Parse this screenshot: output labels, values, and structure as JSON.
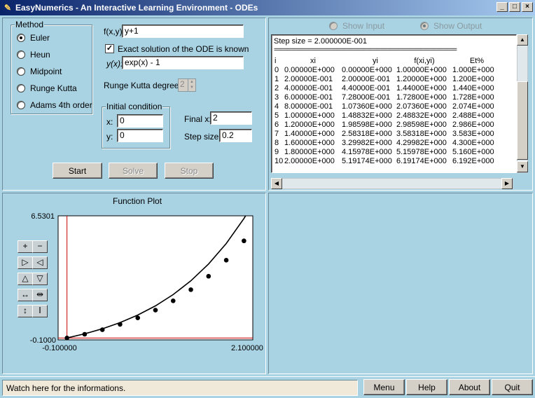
{
  "window": {
    "title": "EasyNumerics - An Interactive Learning Environment - ODEs",
    "buttons": [
      "_",
      "□",
      "×"
    ]
  },
  "method": {
    "legend": "Method",
    "options": [
      "Euler",
      "Heun",
      "Midpoint",
      "Runge Kutta",
      "Adams 4th order"
    ],
    "selected": "Euler"
  },
  "ode": {
    "fxy_label": "f(x,y):",
    "fxy_value": "y+1",
    "exact_checkbox_label": "Exact solution of the ODE is known",
    "exact_checked": true,
    "yx_label": "y(x):",
    "yx_value": "exp(x) - 1",
    "rk_degree_label": "Runge Kutta degree:",
    "rk_degree_value": "2"
  },
  "initial": {
    "legend": "Initial condition",
    "x_label": "x:",
    "x_value": "0",
    "y_label": "y:",
    "y_value": "0"
  },
  "final": {
    "finalx_label": "Final x:",
    "finalx_value": "2",
    "step_label": "Step size:",
    "step_value": "0.2"
  },
  "actions": {
    "start": "Start",
    "solve": "Solve",
    "stop": "Stop"
  },
  "view": {
    "show_input": "Show Input",
    "show_output": "Show Output",
    "selected": "Show Output"
  },
  "output": {
    "step_line": "Step size = 2.000000E-001",
    "separator": "=======================================================",
    "headers": [
      "i",
      "xi",
      "yi",
      "f(xi,yi)",
      "Et%"
    ],
    "rows": [
      [
        "0",
        "0.00000E+000",
        "0.00000E+000",
        "1.00000E+000",
        "1.000E+000"
      ],
      [
        "1",
        "2.00000E-001",
        "2.00000E-001",
        "1.20000E+000",
        "1.200E+000"
      ],
      [
        "2",
        "4.00000E-001",
        "4.40000E-001",
        "1.44000E+000",
        "1.440E+000"
      ],
      [
        "3",
        "6.00000E-001",
        "7.28000E-001",
        "1.72800E+000",
        "1.728E+000"
      ],
      [
        "4",
        "8.00000E-001",
        "1.07360E+000",
        "2.07360E+000",
        "2.074E+000"
      ],
      [
        "5",
        "1.00000E+000",
        "1.48832E+000",
        "2.48832E+000",
        "2.488E+000"
      ],
      [
        "6",
        "1.20000E+000",
        "1.98598E+000",
        "2.98598E+000",
        "2.986E+000"
      ],
      [
        "7",
        "1.40000E+000",
        "2.58318E+000",
        "3.58318E+000",
        "3.583E+000"
      ],
      [
        "8",
        "1.60000E+000",
        "3.29982E+000",
        "4.29982E+000",
        "4.300E+000"
      ],
      [
        "9",
        "1.80000E+000",
        "4.15978E+000",
        "5.15978E+000",
        "5.160E+000"
      ],
      [
        "10",
        "2.00000E+000",
        "5.19174E+000",
        "6.19174E+000",
        "6.192E+000"
      ]
    ]
  },
  "plot": {
    "title": "Function Plot",
    "ymax_label": "6.5301",
    "ymin_label": "-0.1000",
    "xmin_label": "-0.100000",
    "xmax_label": "2.100000",
    "tool_icons": [
      "zoom-in-icon",
      "zoom-out-icon",
      "pan-right-icon",
      "pan-left-icon",
      "pan-up-icon",
      "pan-down-icon",
      "expand-x-icon",
      "shrink-x-icon",
      "expand-y-icon",
      "shrink-y-icon"
    ],
    "tool_glyphs": [
      "+",
      "−",
      "▷",
      "◁",
      "△",
      "▽",
      "↔",
      "⇹",
      "↕",
      "Ⅰ"
    ]
  },
  "chart_data": {
    "type": "scatter",
    "title": "Function Plot",
    "xlim": [
      -0.1,
      2.1
    ],
    "ylim": [
      -0.1,
      6.5301
    ],
    "series": [
      {
        "x": [
          0,
          0.2,
          0.4,
          0.6,
          0.8,
          1.0,
          1.2,
          1.4,
          1.6,
          1.8,
          2.0
        ],
        "values": [
          0,
          0.2,
          0.44,
          0.728,
          1.0736,
          1.48832,
          1.98598,
          2.58318,
          3.29982,
          4.15978,
          5.19174
        ]
      },
      {
        "expression": "exp(x) - 1",
        "x": [
          0,
          0.2,
          0.4,
          0.6,
          0.8,
          1.0,
          1.2,
          1.4,
          1.6,
          1.8,
          2.0,
          2.1
        ],
        "values": [
          0,
          0.2214,
          0.4918,
          0.8221,
          1.2255,
          1.7183,
          2.3201,
          3.0552,
          3.953,
          5.0496,
          6.3891,
          7.1662
        ]
      }
    ]
  },
  "status": {
    "message": "Watch here for the informations."
  },
  "footer": {
    "menu": "Menu",
    "help": "Help",
    "about": "About",
    "quit": "Quit"
  },
  "colors": {
    "background": "#a9d2e3",
    "axis_line": "#cc0000",
    "title_bar": "#0a246a"
  }
}
